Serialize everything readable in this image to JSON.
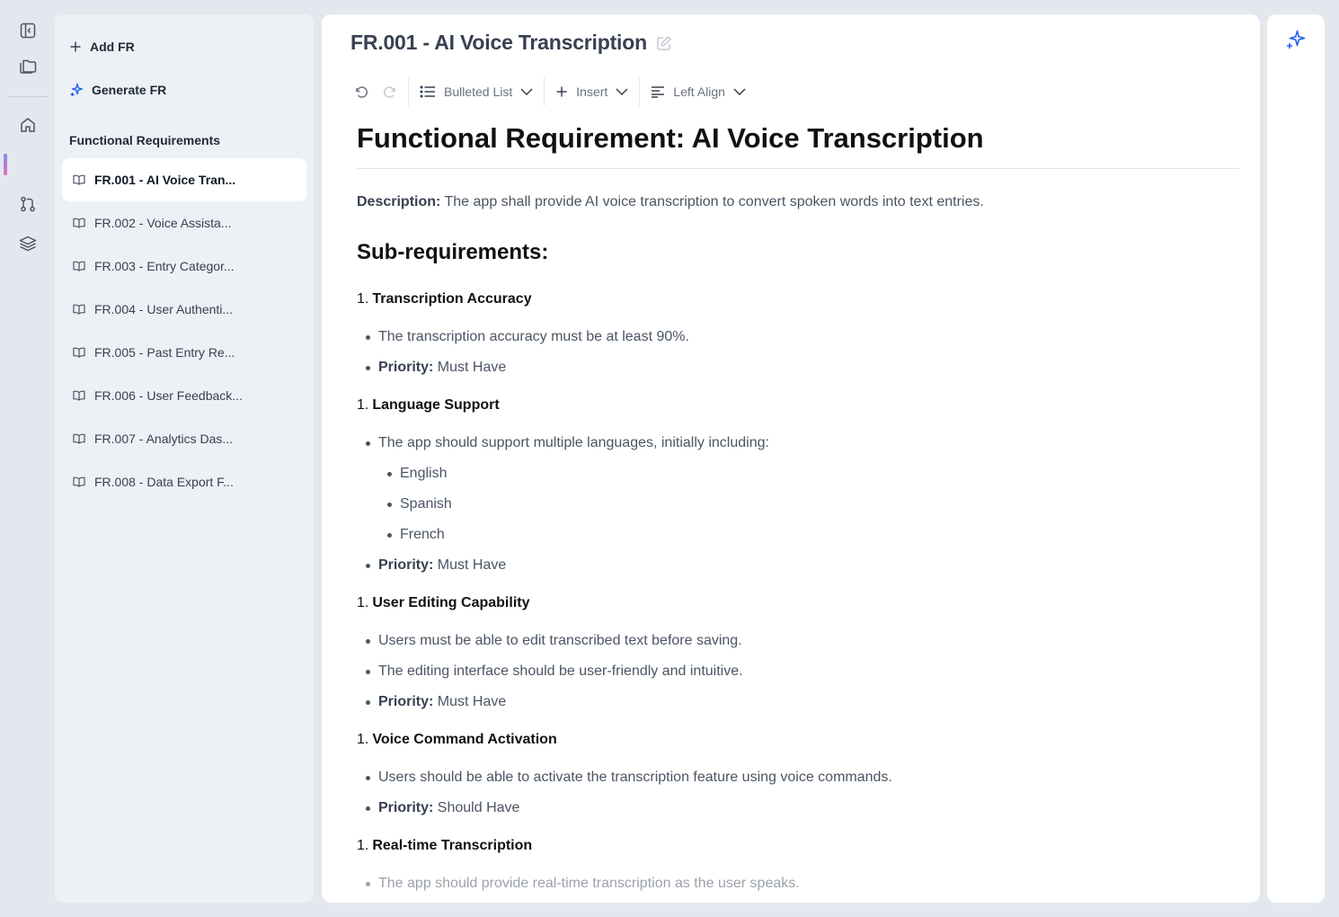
{
  "rail": {
    "icons": [
      "sidebar-toggle-icon",
      "documents-icon",
      "home-icon",
      "git-pull-request-icon",
      "layers-icon"
    ]
  },
  "sidebar": {
    "add_label": "Add FR",
    "generate_label": "Generate FR",
    "heading": "Functional Requirements",
    "items": [
      {
        "label": "FR.001 - AI Voice Tran...",
        "active": true
      },
      {
        "label": "FR.002 - Voice Assista..."
      },
      {
        "label": "FR.003 - Entry Categor..."
      },
      {
        "label": "FR.004 - User Authenti..."
      },
      {
        "label": "FR.005 - Past Entry Re..."
      },
      {
        "label": "FR.006 - User Feedback..."
      },
      {
        "label": "FR.007 - Analytics Das..."
      },
      {
        "label": "FR.008 - Data Export F..."
      }
    ]
  },
  "main": {
    "title": "FR.001 - AI Voice Transcription",
    "toolbar": {
      "list_label": "Bulleted List",
      "insert_label": "Insert",
      "align_label": "Left Align"
    },
    "doc": {
      "h1": "Functional Requirement: AI Voice Transcription",
      "description_label": "Description:",
      "description": "The app shall provide AI voice transcription to convert spoken words into text entries.",
      "h2": "Sub-requirements:",
      "priority_label": "Priority:",
      "sections": [
        {
          "number": "1.",
          "title": "Transcription Accuracy",
          "bullets": [
            "The transcription accuracy must be at least 90%."
          ],
          "priority": "Must Have"
        },
        {
          "number": "1.",
          "title": "Language Support",
          "bullets": [
            "The app should support multiple languages, initially including:"
          ],
          "sub_bullets": [
            "English",
            "Spanish",
            "French"
          ],
          "priority": "Must Have"
        },
        {
          "number": "1.",
          "title": "User Editing Capability",
          "bullets": [
            "Users must be able to edit transcribed text before saving.",
            "The editing interface should be user-friendly and intuitive."
          ],
          "priority": "Must Have"
        },
        {
          "number": "1.",
          "title": "Voice Command Activation",
          "bullets": [
            "Users should be able to activate the transcription feature using voice commands."
          ],
          "priority": "Should Have"
        },
        {
          "number": "1.",
          "title": "Real-time Transcription",
          "bullets": [
            "The app should provide real-time transcription as the user speaks."
          ]
        }
      ]
    }
  },
  "colors": {
    "background": "#e3e8ef",
    "sidebar": "#edf1f6",
    "accent": "#2563eb"
  }
}
